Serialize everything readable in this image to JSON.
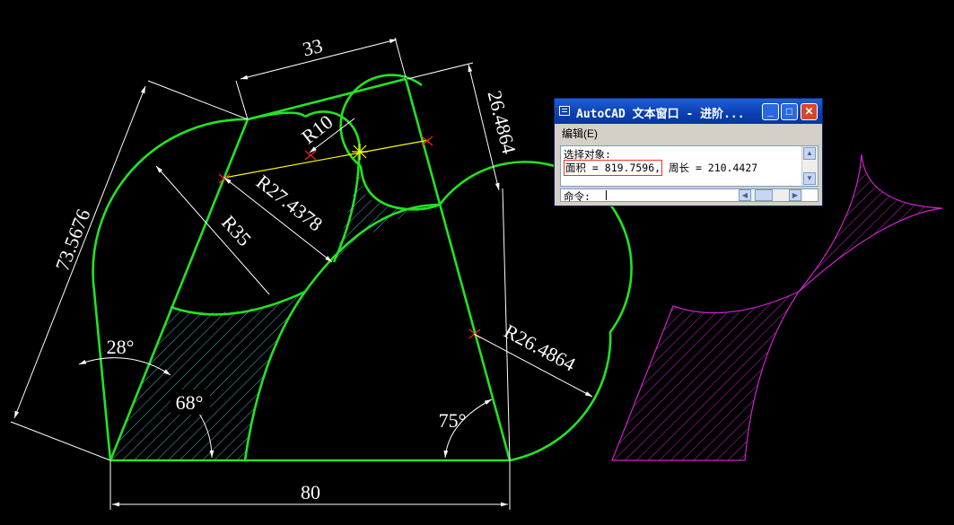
{
  "dimensions": {
    "top_width": "33",
    "right_edge": "26.4864",
    "left_side": "73.5676",
    "bottom": "80",
    "radius_r10": "R10",
    "radius_r27": "R27.4378",
    "radius_r35": "R35",
    "radius_r26": "R26.4864",
    "angle_28": "28°",
    "angle_68": "68°",
    "angle_75": "75°"
  },
  "text_window": {
    "title": "AutoCAD 文本窗口 - 进阶...",
    "minimize_label": "_",
    "maximize_label": "□",
    "close_label": "✕",
    "menu_edit": "编辑(E)",
    "output_line1": "选择对象:",
    "area_text": "面积 = 819.7596,",
    "perimeter_text": " 周长 = 210.4427",
    "command_label": "命令:",
    "command_value": ""
  },
  "colors": {
    "geometry": "#22e322",
    "dimension": "#ffffff",
    "hatch": "#4bb0c8",
    "highlight": "#d020d0",
    "construction": "#ffff00",
    "marker": "#ff2020"
  }
}
